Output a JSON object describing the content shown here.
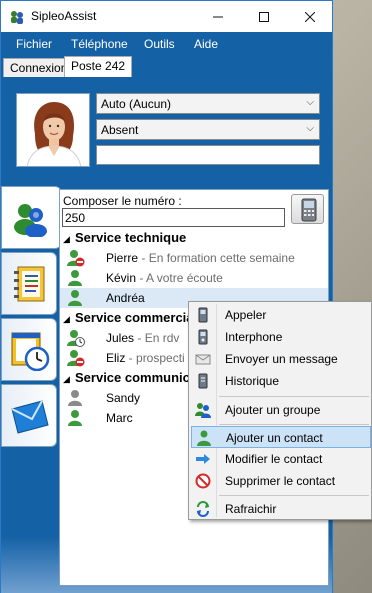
{
  "window": {
    "title": "SipleoAssist"
  },
  "menu": [
    "Fichier",
    "Téléphone",
    "Outils",
    "Aide"
  ],
  "tabs": [
    {
      "label": "Connexion",
      "active": false
    },
    {
      "label": "Poste 242",
      "active": true
    }
  ],
  "status": {
    "mode_value": "Auto (Aucun)",
    "presence_value": "Absent",
    "message_value": ""
  },
  "side_tabs": [
    "contacts-icon",
    "address-book-icon",
    "calendar-clock-icon",
    "mail-icon"
  ],
  "compose": {
    "label": "Composer le numéro :",
    "value": "250"
  },
  "groups": [
    {
      "name": "Service technique",
      "contacts": [
        {
          "name": "Pierre",
          "status": "En formation cette semaine",
          "icon": "user-busy-icon"
        },
        {
          "name": "Kévin",
          "status": "A votre écoute",
          "icon": "user-available-icon"
        },
        {
          "name": "Andréa",
          "status": "",
          "icon": "user-available-icon",
          "selected": true
        }
      ]
    },
    {
      "name": "Service commercia",
      "contacts": [
        {
          "name": "Jules",
          "status": "En rdv",
          "icon": "user-away-icon"
        },
        {
          "name": "Eliz",
          "status": "prospecti",
          "icon": "user-busy-icon"
        }
      ]
    },
    {
      "name": "Service communic",
      "contacts": [
        {
          "name": "Sandy",
          "status": "",
          "icon": "user-offline-icon"
        },
        {
          "name": "Marc",
          "status": "",
          "icon": "user-available-icon"
        }
      ]
    }
  ],
  "context_menu": {
    "call": "Appeler",
    "intercom": "Interphone",
    "message": "Envoyer un message",
    "history": "Historique",
    "add_group": "Ajouter un groupe",
    "add_contact": "Ajouter un contact",
    "edit_contact": "Modifier le contact",
    "delete_contact": "Supprimer le contact",
    "refresh": "Rafraichir"
  },
  "colors": {
    "accent": "#1561a6",
    "highlight": "#cce3f7",
    "selected_row": "#dbe9f7"
  }
}
